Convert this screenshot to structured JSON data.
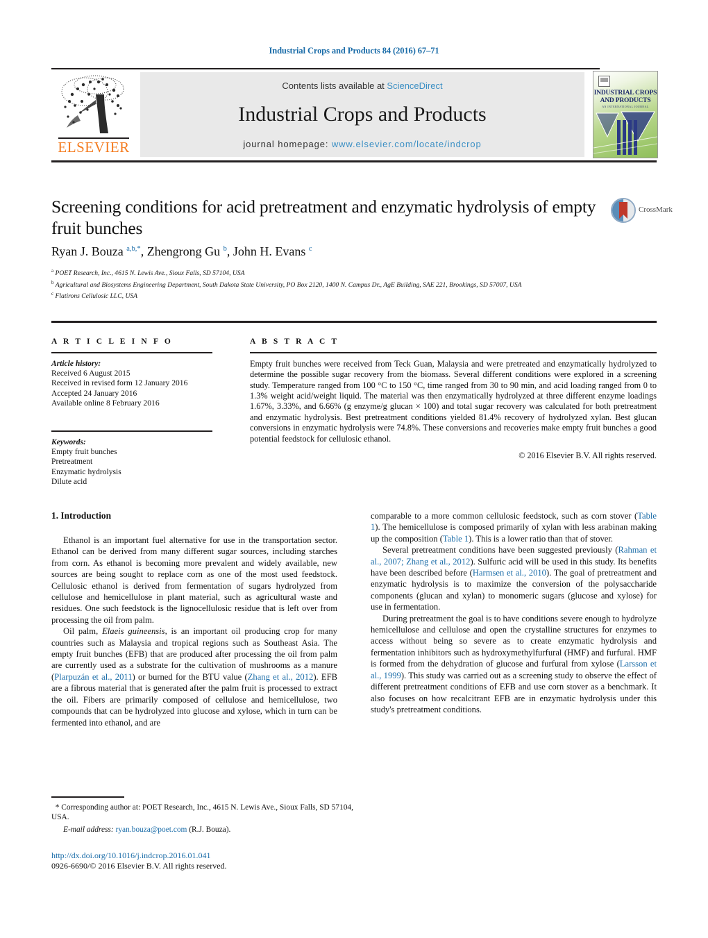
{
  "running_head": "Industrial Crops and Products 84 (2016) 67–71",
  "masthead": {
    "contents_prefix": "Contents lists available at ",
    "sciencedirect": "ScienceDirect",
    "journal_title": "Industrial Crops and Products",
    "homepage_label": "journal homepage: ",
    "homepage_url": "www.elsevier.com/locate/indcrop",
    "publisher_wordmark": "ELSEVIER",
    "publisher_logo_name": "elsevier-tree-logo",
    "cover_title": "INDUSTRIAL CROPS AND PRODUCTS",
    "cover_subtitle": "AN INTERNATIONAL JOURNAL"
  },
  "article": {
    "title": "Screening conditions for acid pretreatment and enzymatic hydrolysis of empty fruit bunches",
    "authors_html": "Ryan J. Bouza <sup>a,b,*</sup>, Zhengrong Gu <sup>b</sup>, John H. Evans <sup>c</sup>",
    "affiliations": [
      {
        "marker": "a",
        "text": "POET Research, Inc., 4615 N. Lewis Ave., Sioux Falls, SD 57104, USA"
      },
      {
        "marker": "b",
        "text": "Agricultural and Biosystems Engineering Department, South Dakota State University, PO Box 2120, 1400 N. Campus Dr., AgE Building, SAE 221, Brookings, SD 57007, USA"
      },
      {
        "marker": "c",
        "text": "Flatirons Cellulosic LLC, USA"
      }
    ],
    "crossmark_label": "CrossMark"
  },
  "article_info": {
    "heading": "A R T I C L E   I N F O",
    "history_label": "Article history:",
    "history": [
      "Received 6 August 2015",
      "Received in revised form 12 January 2016",
      "Accepted 24 January 2016",
      "Available online 8 February 2016"
    ],
    "keywords_label": "Keywords:",
    "keywords": [
      "Empty fruit bunches",
      "Pretreatment",
      "Enzymatic hydrolysis",
      "Dilute acid"
    ]
  },
  "abstract": {
    "heading": "A B S T R A C T",
    "text": "Empty fruit bunches were received from Teck Guan, Malaysia and were pretreated and enzymatically hydrolyzed to determine the possible sugar recovery from the biomass. Several different conditions were explored in a screening study. Temperature ranged from 100 °C to 150 °C, time ranged from 30 to 90 min, and acid loading ranged from 0 to 1.3% weight acid/weight liquid. The material was then enzymatically hydrolyzed at three different enzyme loadings 1.67%, 3.33%, and 6.66% (g enzyme/g glucan × 100) and total sugar recovery was calculated for both pretreatment and enzymatic hydrolysis. Best pretreatment conditions yielded 81.4% recovery of hydrolyzed xylan. Best glucan conversions in enzymatic hydrolysis were 74.8%. These conversions and recoveries make empty fruit bunches a good potential feedstock for cellulosic ethanol.",
    "copyright": "© 2016 Elsevier B.V. All rights reserved."
  },
  "body": {
    "section_number_title": "1.  Introduction",
    "left_paragraph_1": "Ethanol is an important fuel alternative for use in the transportation sector. Ethanol can be derived from many different sugar sources, including starches from corn. As ethanol is becoming more prevalent and widely available, new sources are being sought to replace corn as one of the most used feedstock. Cellulosic ethanol is derived from fermentation of sugars hydrolyzed from cellulose and hemicellulose in plant material, such as agricultural waste and residues. One such feedstock is the lignocellulosic residue that is left over from processing the oil from palm.",
    "left_paragraph_2_pre": "Oil palm, ",
    "left_paragraph_2_italic": "Elaeis guineensis",
    "left_paragraph_2_a": ", is an important oil producing crop for many countries such as Malaysia and tropical regions such as Southeast Asia. The empty fruit bunches (EFB) that are produced after processing the oil from palm are currently used as a substrate for the cultivation of mushrooms as a manure (",
    "left_cite_1": "Plarpuzán et al., 2011",
    "left_paragraph_2_b": ") or burned for the BTU value (",
    "left_cite_2": "Zhang et al., 2012",
    "left_paragraph_2_c": "). EFB are a fibrous material that is generated after the palm fruit is processed to extract the oil. Fibers are primarily composed of cellulose and hemicellulose, two compounds that can be hydrolyzed into glucose and xylose, which in turn can be fermented into ethanol, and are",
    "right_paragraph_1_a": "comparable to a more common cellulosic feedstock, such as corn stover (",
    "right_cite_table1_a": "Table 1",
    "right_paragraph_1_b": "). The hemicellulose is composed primarily of xylan with less arabinan making up the composition (",
    "right_cite_table1_b": "Table 1",
    "right_paragraph_1_c": "). This is a lower ratio than that of stover.",
    "right_paragraph_2_a": "Several pretreatment conditions have been suggested previously (",
    "right_cite_3": "Rahman et al., 2007; Zhang et al., 2012",
    "right_paragraph_2_b": "). Sulfuric acid will be used in this study. Its benefits have been described before (",
    "right_cite_4": "Harmsen et al., 2010",
    "right_paragraph_2_c": "). The goal of pretreatment and enzymatic hydrolysis is to maximize the conversion of the polysaccharide components (glucan and xylan) to monomeric sugars (glucose and xylose) for use in fermentation.",
    "right_paragraph_3_a": "During pretreatment the goal is to have conditions severe enough to hydrolyze hemicellulose and cellulose and open the crystalline structures for enzymes to access without being so severe as to create enzymatic hydrolysis and fermentation inhibitors such as hydroxymethylfurfural (HMF) and furfural. HMF is formed from the dehydration of glucose and furfural from xylose (",
    "right_cite_5": "Larsson et al., 1999",
    "right_paragraph_3_b": "). This study was carried out as a screening study to observe the effect of different pretreatment conditions of EFB and use corn stover as a benchmark. It also focuses on how recalcitrant EFB are in enzymatic hydrolysis under this study's pretreatment conditions."
  },
  "footer": {
    "corresponding_marker": "*",
    "corresponding_text": "Corresponding author at: POET Research, Inc., 4615 N. Lewis Ave., Sioux Falls, SD 57104, USA.",
    "email_label": "E-mail address:",
    "email": "ryan.bouza@poet.com",
    "email_suffix": "(R.J. Bouza).",
    "doi": "http://dx.doi.org/10.1016/j.indcrop.2016.01.041",
    "issn_line": "0926-6690/© 2016 Elsevier B.V. All rights reserved."
  },
  "colors": {
    "link": "#1a6ca8",
    "sciencedirect": "#3b8fc4",
    "elsevier_orange": "#f47c20",
    "cover_green": "#8fbf5a",
    "cover_navy": "#1d2a6b"
  }
}
